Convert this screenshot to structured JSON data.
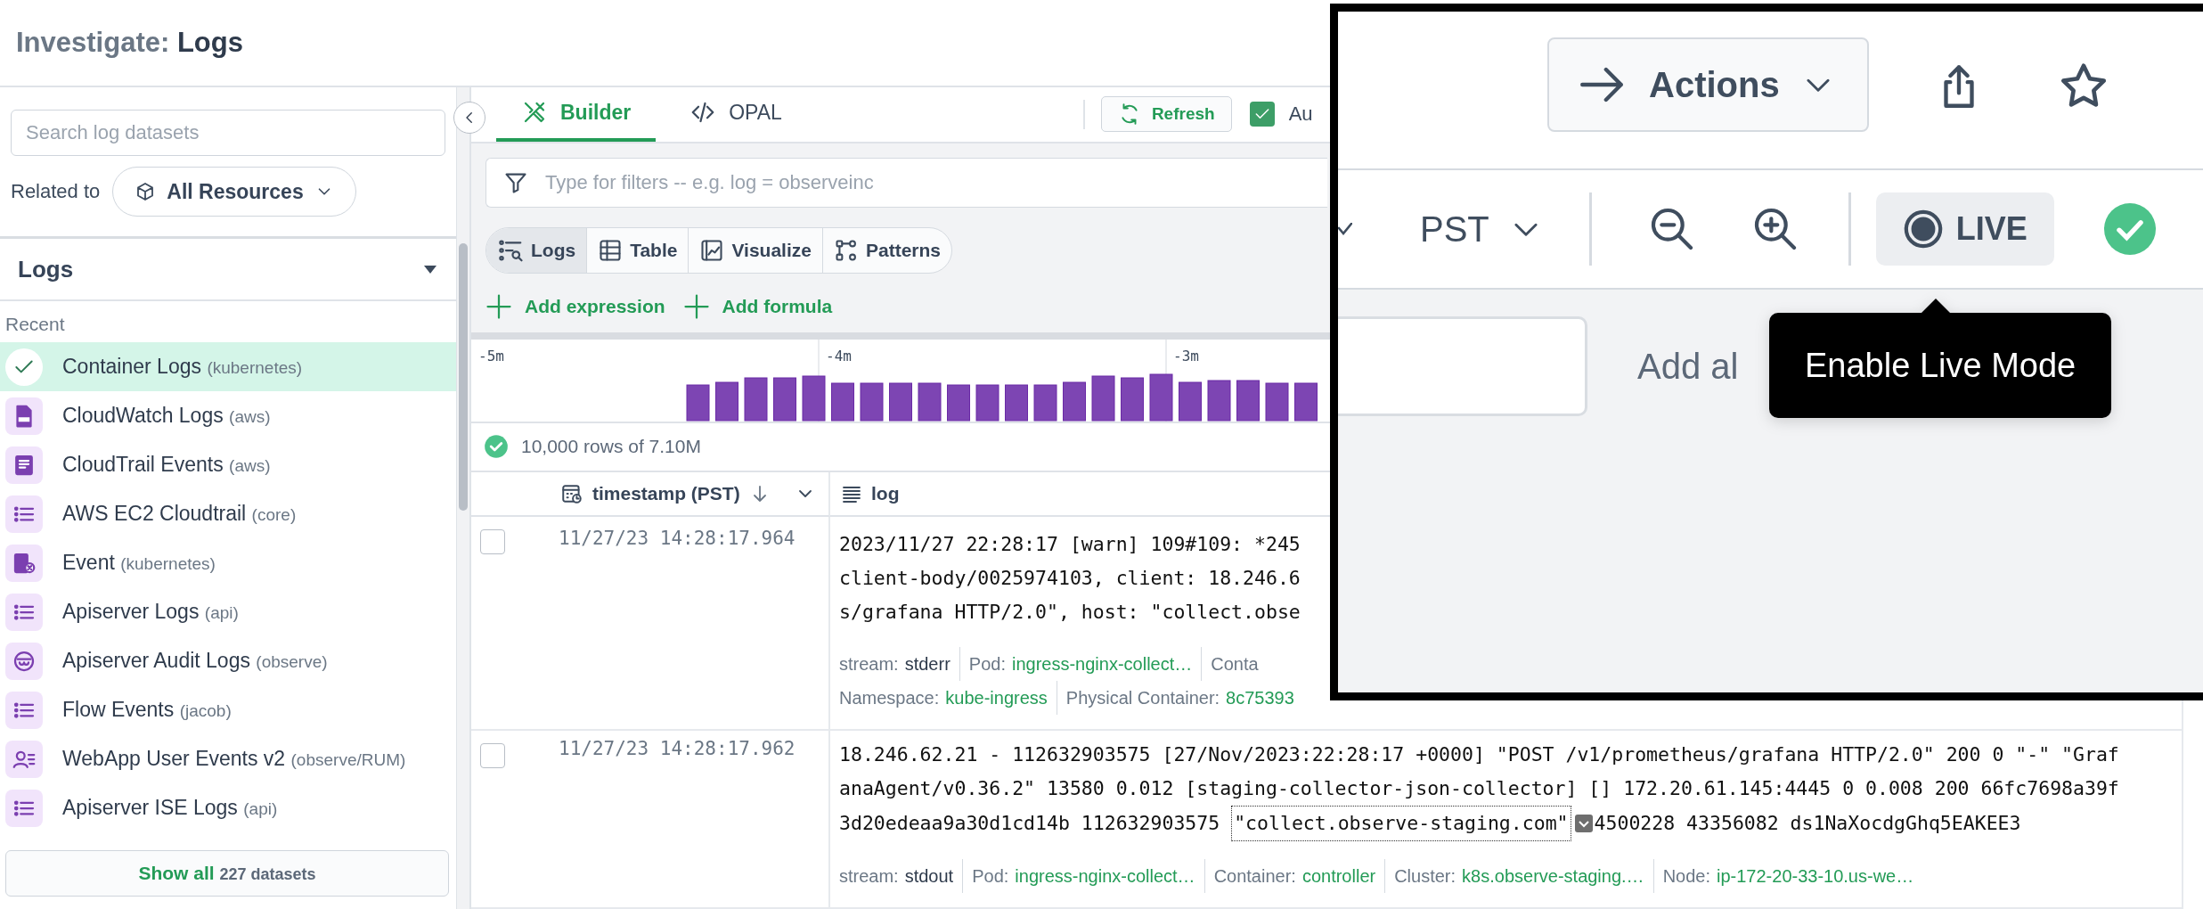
{
  "header": {
    "title_prefix": "Investigate:",
    "title": "Logs"
  },
  "sidebar": {
    "search": {
      "placeholder": "Search log datasets"
    },
    "related_label": "Related to",
    "related_value": "All Resources",
    "section": {
      "title": "Logs",
      "expanded": true
    },
    "group_label": "Recent",
    "items": [
      {
        "name": "Container Logs",
        "namespace": "(kubernetes)",
        "selected": true
      },
      {
        "name": "CloudWatch Logs",
        "namespace": "(aws)",
        "kind": "file",
        "selected": false
      },
      {
        "name": "CloudTrail Events",
        "namespace": "(aws)",
        "kind": "document",
        "selected": false
      },
      {
        "name": "AWS EC2 Cloudtrail",
        "namespace": "(core)",
        "kind": "list",
        "selected": false
      },
      {
        "name": "Event",
        "namespace": "(kubernetes)",
        "kind": "event",
        "selected": false
      },
      {
        "name": "Apiserver Logs",
        "namespace": "(api)",
        "kind": "list",
        "selected": false
      },
      {
        "name": "Apiserver Audit Logs",
        "namespace": "(observe)",
        "kind": "audit",
        "selected": false
      },
      {
        "name": "Flow Events",
        "namespace": "(jacob)",
        "kind": "list",
        "selected": false
      },
      {
        "name": "WebApp User Events v2",
        "namespace": "(observe/RUM)",
        "kind": "user",
        "selected": false
      },
      {
        "name": "Apiserver ISE Logs",
        "namespace": "(api)",
        "kind": "list",
        "selected": false
      }
    ],
    "show_all": {
      "label": "Show all",
      "count": "227 datasets"
    }
  },
  "toolbar": {
    "tabs": [
      {
        "label": "Builder",
        "kind": "builder",
        "selected": true
      },
      {
        "label": "OPAL",
        "kind": "code",
        "selected": false
      }
    ],
    "refresh": "Refresh",
    "auto": {
      "label": "Au",
      "checked": true
    }
  },
  "query": {
    "filter": {
      "placeholder": "Type for filters -- e.g. log = observeinc"
    },
    "views": [
      {
        "label": "Logs",
        "kind": "logs",
        "selected": true
      },
      {
        "label": "Table",
        "kind": "table",
        "selected": false
      },
      {
        "label": "Visualize",
        "kind": "chart",
        "selected": false
      },
      {
        "label": "Patterns",
        "kind": "patterns",
        "selected": false
      }
    ],
    "add_buttons": [
      "Add expression",
      "Add formula"
    ]
  },
  "histogram": {
    "ticks": [
      "-5m",
      "-4m",
      "-3m"
    ]
  },
  "status": {
    "text": "10,000 rows of 7.10M"
  },
  "table": {
    "columns": [
      {
        "label": "timestamp (PST)",
        "kind": "time",
        "sorted_desc": true
      },
      {
        "label": "log",
        "kind": "text"
      }
    ],
    "rows": [
      {
        "checked": false,
        "timestamp": "11/27/23 14:28:17.964",
        "log": [
          {
            "kind": "plain",
            "text": "2023/11/27 22:28:17 [warn] 109#109: *245"
          },
          {
            "kind": "plain",
            "text": "client-body/0025974103, client: 18.246.6"
          },
          {
            "kind": "plain",
            "text": "s/grafana HTTP/2.0\", host: \"collect.obse"
          }
        ],
        "meta": [
          [
            {
              "key": "stream:",
              "value": "stderr",
              "kind": "plain"
            },
            {
              "key": "Pod:",
              "value": "ingress-nginx-collect…",
              "kind": "link"
            },
            {
              "key": "Conta"
            }
          ],
          [
            {
              "key": "Namespace:",
              "value": "kube-ingress",
              "kind": "link"
            },
            {
              "key": "Physical Container:",
              "value": "8c75393",
              "kind": "link"
            }
          ]
        ]
      },
      {
        "checked": false,
        "timestamp": "11/27/23 14:28:17.962",
        "log": [
          {
            "kind": "plain",
            "text": "18.246.62.21 - 112632903575 [27/Nov/2023:22:28:17 +0000] \"POST /v1/prometheus/grafana HTTP/2.0\" 200 0 \"-\" \"Graf"
          },
          {
            "kind": "plain",
            "text": "anaAgent/v0.36.2\" 13580 0.012 [staging-collector-json-collector] [] 172.20.61.145:4445 0 0.008 200 66fc7698a39f"
          },
          {
            "kind": "token",
            "before": "3d20edeaa9a30d1cd14b 112632903575",
            "token": "\"collect.observe-staging.com\"",
            "after": "4500228 43356082 ds1NaXocdgGhq5EAKEE3"
          }
        ],
        "meta": [
          [
            {
              "key": "stream:",
              "value": "stdout",
              "kind": "plain"
            },
            {
              "key": "Pod:",
              "value": "ingress-nginx-collect…",
              "kind": "link"
            },
            {
              "key": "Container:",
              "value": "controller",
              "kind": "link"
            },
            {
              "key": "Cluster:",
              "value": "k8s.observe-staging.…",
              "kind": "link"
            },
            {
              "key": "Node:",
              "value": "ip-172-20-33-10.us-we…",
              "kind": "link"
            }
          ]
        ]
      }
    ]
  },
  "inset": {
    "actions": "Actions",
    "timezone": "PST",
    "live": "LIVE",
    "add_text": "Add al",
    "tooltip": "Enable Live Mode"
  }
}
